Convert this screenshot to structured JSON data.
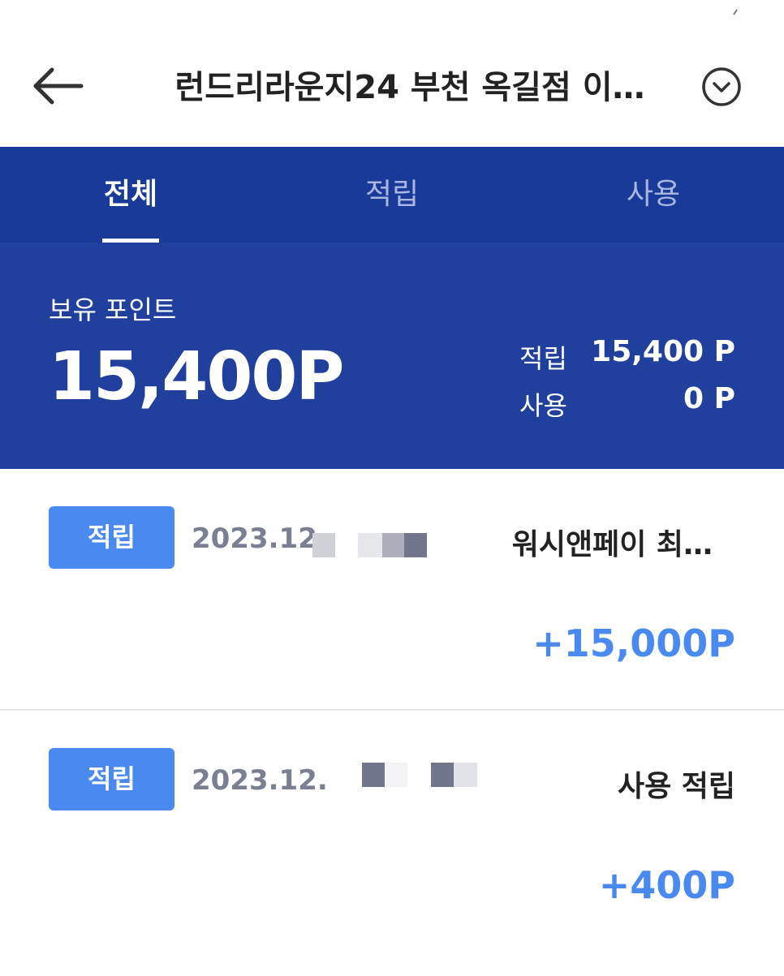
{
  "header": {
    "title": "런드리라운지24 부천 옥길점 이…",
    "back_icon": "arrow-left-icon",
    "dropdown_icon": "chevron-down-circle-icon"
  },
  "tabs": [
    {
      "label": "전체",
      "active": true
    },
    {
      "label": "적립",
      "active": false
    },
    {
      "label": "사용",
      "active": false
    }
  ],
  "summary": {
    "label": "보유 포인트",
    "points": "15,400P",
    "earned_label": "적립",
    "earned_value": "15,400 P",
    "used_label": "사용",
    "used_value": "0 P"
  },
  "transactions": [
    {
      "badge": "적립",
      "date": "2023.12.",
      "description": "워시앤페이 최…",
      "amount": "+15,000P"
    },
    {
      "badge": "적립",
      "date": "2023.12.",
      "description": "사용 적립",
      "amount": "+400P"
    }
  ],
  "colors": {
    "tab_bar": "#1a3a9a",
    "summary_bg": "#213f9d",
    "badge": "#4a8af0",
    "amount": "#4a8af0",
    "date": "#7a8091"
  }
}
